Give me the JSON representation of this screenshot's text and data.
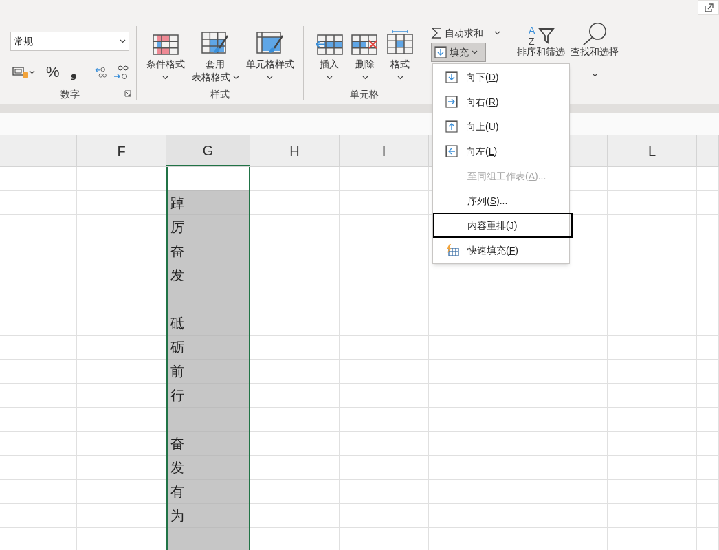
{
  "ribbon": {
    "number_group": {
      "label": "数字",
      "format_value": "常规",
      "buttons": [
        {
          "kind": "accounting"
        },
        {
          "kind": "caret"
        },
        {
          "kind": "percent",
          "text": "%"
        },
        {
          "kind": "comma",
          "text": "❟"
        },
        {
          "kind": "increase_decimal"
        },
        {
          "kind": "decrease_decimal"
        }
      ]
    },
    "style_group": {
      "label": "样式",
      "buttons": [
        {
          "lines": [
            "条件格式"
          ]
        },
        {
          "lines": [
            "套用",
            "表格格式"
          ]
        },
        {
          "lines": [
            "单元格样式"
          ]
        }
      ]
    },
    "cells_group": {
      "label": "单元格",
      "buttons": [
        {
          "lines": [
            "插入"
          ]
        },
        {
          "lines": [
            "删除"
          ]
        },
        {
          "lines": [
            "格式"
          ]
        }
      ]
    },
    "editing_group": {
      "autosum": "自动求和",
      "fill": "填充",
      "fill_open": true,
      "buttons": [
        {
          "lines": [
            "排序和筛选"
          ],
          "icon_letters": [
            "A",
            "Z"
          ]
        },
        {
          "lines": [
            "查找和选择"
          ]
        }
      ]
    }
  },
  "fill_menu": [
    {
      "before": "向下(",
      "key": "D",
      "after": ")",
      "disabled": false,
      "selected": false
    },
    {
      "before": "向右(",
      "key": "R",
      "after": ")",
      "disabled": false,
      "selected": false
    },
    {
      "before": "向上(",
      "key": "U",
      "after": ")",
      "disabled": false,
      "selected": false
    },
    {
      "before": "向左(",
      "key": "L",
      "after": ")",
      "disabled": false,
      "selected": false
    },
    {
      "before": "至同组工作表(",
      "key": "A",
      "after": ")...",
      "disabled": true,
      "selected": false
    },
    {
      "before": "序列(",
      "key": "S",
      "after": ")...",
      "disabled": false,
      "selected": false
    },
    {
      "before": "内容重排(",
      "key": "J",
      "after": ")",
      "disabled": false,
      "selected": true
    },
    {
      "before": "快速填充(",
      "key": "F",
      "after": ")",
      "disabled": false,
      "selected": false
    }
  ],
  "sheet": {
    "columns": [
      {
        "selected": false
      },
      {
        "label": "F",
        "selected": false
      },
      {
        "label": "G",
        "selected": true
      },
      {
        "label": "H",
        "selected": false
      },
      {
        "label": "I",
        "selected": false
      },
      {
        "selected": false
      },
      {
        "label": "L",
        "selected": false
      },
      {
        "selected": false
      }
    ],
    "column_g": [
      {
        "active": true
      },
      {
        "value": "踔",
        "active": false
      },
      {
        "value": "厉",
        "active": false
      },
      {
        "value": "奋",
        "active": false
      },
      {
        "value": "发",
        "active": false
      },
      {
        "active": false
      },
      {
        "value": "砥",
        "active": false
      },
      {
        "value": "砺",
        "active": false
      },
      {
        "value": "前",
        "active": false
      },
      {
        "value": "行",
        "active": false
      },
      {
        "active": false
      },
      {
        "value": "奋",
        "active": false
      },
      {
        "value": "发",
        "active": false
      },
      {
        "value": "有",
        "active": false
      },
      {
        "value": "为",
        "active": false
      },
      {
        "active": false
      }
    ]
  }
}
